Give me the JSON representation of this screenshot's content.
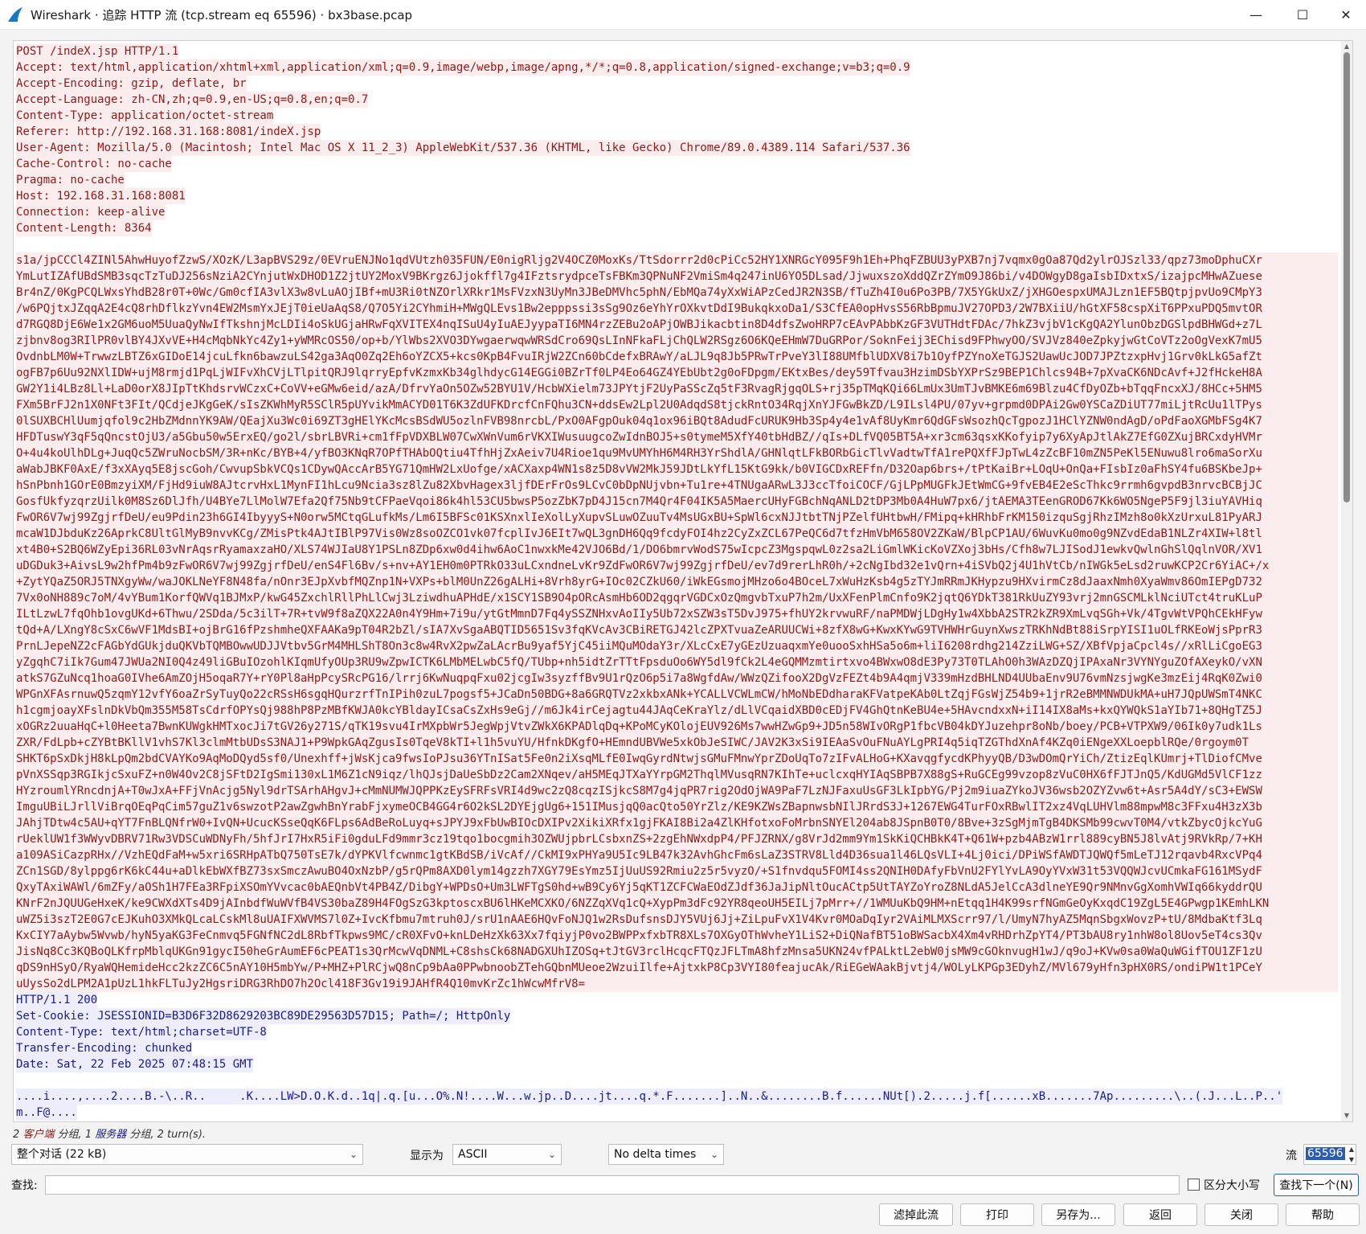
{
  "window": {
    "title": "Wireshark · 追踪 HTTP 流 (tcp.stream eq 65596) · bx3base.pcap",
    "controls": {
      "minimize": "—",
      "maximize": "☐",
      "close": "✕"
    }
  },
  "request_headers": [
    "POST /indeX.jsp HTTP/1.1",
    "Accept: text/html,application/xhtml+xml,application/xml;q=0.9,image/webp,image/apng,*/*;q=0.8,application/signed-exchange;v=b3;q=0.9",
    "Accept-Encoding: gzip, deflate, br",
    "Accept-Language: zh-CN,zh;q=0.9,en-US;q=0.8,en;q=0.7",
    "Content-Type: application/octet-stream",
    "Referer: http://192.168.31.168:8081/indeX.jsp",
    "User-Agent: Mozilla/5.0 (Macintosh; Intel Mac OS X 11_2_3) AppleWebKit/537.36 (KHTML, like Gecko) Chrome/89.0.4389.114 Safari/537.36",
    "Cache-Control: no-cache",
    "Pragma: no-cache",
    "Host: 192.168.31.168:8081",
    "Connection: keep-alive",
    "Content-Length: 8364"
  ],
  "request_body": [
    "s1a/jpCCCl4ZINl5AhwHuyofZzwS/XOzK/L3apBVS29z/0EVruENJNo1qdVUtzh035FUN/E0nigRljg2V4OCZ0MoxKs/TtSdorrr2d0cPiCc52HY1XNRGcY095F9h1Eh+PhqFZBUU3yPXB7nj7vqmx0gOa87Qd2ylrOJSzl33/qpz73moDphuCXr",
    "YmLutIZAfUBdSMB3sqcTzTuDJ256sNziA2CYnjutWxDHOD1Z2jtUY2MoxV9BKrgz6Jjokffl7g4IFztsrydpceTsFBKm3QPNuNF2VmiSm4q247inU6YO5DLsad/JjwuxszoXddQZrZYmO9J86bi/v4DOWgyD8gaIsbIDxtxS/izajpcMHwAZuese",
    "Br4nZ/0KgPCQLWxsYhdB28r0T+0Wc/Gm0cfIA3vlX3w8vLuAOjIBf+mU3Ri0tNZOrlXRkr1MsFVzxN3UyMn3JBeDMVhc5phN/EbMQa74yXxWiAPzCedJR2N3SB/fTuZh4I0u6Po3PB/7X5YGkUxZ/jXHGOespxUMAJLzn1EF5BQtpjpvUo9CMpY3",
    "/w6PQjtxJZqqA2E4cQ8rhDflkzYvn4EW2MsmYxJEjT0ieUaAqS8/Q7O5Yi2CYhmiH+MWgQLEvs1Bw2epppssi3sSg9Oz6eYhYrOXkvtDdI9BukqkxoDa1/S3CfEA0opHvsS56RbBpmuJV27OPD3/2W7BXiiU/hGtXF58cspXiT6PPxuPDQ5mvtOR",
    "d7RGQ8DjE6We1x2GM6uoM5UuaQyNwIfTkshnjMcLDIi4oSkUGjaHRwFqXVITEX4nqISuU4yIuAEJyypaTI6MN4rzZEBu2oAPjOWBJikacbtin8D4dfsZwoHRP7cEAvPAbbKzGF3VUTHdtFDAc/7hkZ3vjbV1cKgQA2YlunObzDGSlpdBHWGd+z7L",
    "zjbnv8og3RIlPR0vlBY4JXvVE+H4cMqbNkYc4Zy1+yWMRcOS50/op+b/YlWbs2XVO3DYwgaerwqwWRSdCro69QsLInNFkaFLjChQLW2RSgz6O6KQeEHmW7DuGRPor/SoknFeij3EChisd9FPhwyOO/SVJVz840eZpkyjwGtCoVTz2oOgVexK7mU5",
    "OvdnbLM0W+TrwwzLBTZ6xGIDoE14jcuLfkn6bawzuLS42ga3AqO0Zq2Eh6oYZCX5+kcs0KpB4FvuIRjW2ZCn60bCdefxBRAwY/aLJL9q8Jb5PRwTrPveY3lI88UMfblUDXV8i7b1OyfPZYnoXeTGJS2UawUcJOD7JPZtzxpHvj1Grv0kLkG5afZt",
    "ogFB7p6Uu92NXlIDW+ujM8rmjd1PqLjWIFvXhCVjLTlpitQRJ9lqrryEpfvKzmxKb34glhdycG14EGGi0BZrTf0LP4Eo64GZ4YEbUbt2g0oFDpgm/EKtxBes/dey59Tfvau3HzimDSbYXPrSz9BEP1Chlcs94B+7pXvaCK6NDcAvf+J2fHckeH8A",
    "GW2Y1i4LBz8Ll+LaD0orX8JIpTtKhdsrvWCzxC+CoVV+eGMw6eid/azA/DfrvYaOn5OZw52BYU1V/HcbWXielm73JPYtjF2UyPaSScZq5tF3RvagRjgqOLS+rj35pTMqKQi66LmUx3UmTJvBMKE6m69Blzu4CfDyOZb+bTqqFncxXJ/8HCc+5HM5",
    "FXm5BrFJ2n1X0NFt3FIt/QCdjeJKgGeK/sIsZKWhMyR5SClR5pUYvikMmACYD01T6K3ZdUFKDrcfCnFQhu3CN+ddsEw2Lpl2U0AdqdS8tjckRntO34RqjXnYJFGwBkZD/L9ILsl4PU/07yv+grpmd0DPAi2Gw0YSCaZDiUT77miLjtRcUu1lTPys",
    "0lSUXBCHlUumjqfol9c2HbZMdnnYK9AW/QEajXu3Wc0i69ZT3gHElYKcMcsBSdWU5ozlnFVB98nrcbL/PxO0AFgpOuk04q1ox96iBQt8AdudFcURUK9Hb3Sp4y4e1vAf8UyKmr6QdGFsWsozhQcTgpozJ1HClYZNW0ndAgD/oPdFaoXGMbFSg4K7",
    "HFDTuswY3qF5qQncstOjU3/a5Gbu50w5ErxEQ/go2l/sbrLBVRi+cm1fFpVDXBLW07CwXWnVum6rVKXIWusuugcoZwIdnBOJ5+s0tymeM5XfY40tbHdBZ//qIs+DLfVQ05BT5A+xr3cm63qsxKKofyip7y6XyApJtlAkZ7EfG0ZXujBRCxdyHVMr",
    "O+4u4koUlhDLg+JuqQc5ZWruNocbSM/3R+nKc/BYB+4/yfBO3KNqR7OPfTHAbOQtiu4TfhHjZxAeiv7U4Rioe1qu9MvUMYhH6M4RH3YrShdlA/GHNlqtLFkBORbGicTlvVadtwTfA1rePQXfFJpTwL4zZcBF10mZN5PeKl5ENuwu8lro6maSorXu",
    "aWabJBKF0AxE/f3xXAyq5E8jscGoh/CwvupSbkVCQs1CDywQAccArB5YG71QmHW2LxUofge/xACXaxp4WN1s8z5D8vVW2MkJ59JDtLkYfL15KtG9kk/b0VIGCDxREFfn/D32Oap6brs+/tPtKaiBr+LOqU+OnQa+FIsbIz0aFhSY4fu6BSKbeJp+",
    "hSnPbnh1GOrE0BmzyiXM/FjHd9iuW8AJtcrvHxL1MynFI1hLcu9Ncia3sz8lZu82XbvHagex3ljfDErFrOs9LCvC0bDpNUjvbn+Tu1re+4TNUgaARwL3J3ccTfoiCOCF/GjLPpMUGFkJEtWmCG+9fvEB4E2eScThkc9rrmh6gvpdB3nrvcBCBjJC",
    "GosfUkfyzqrzUilk0M8Sz6DlJfh/U4BYe7LlMolW7Efa2Qf75Nb9tCFPaeVqoi86k4hl53CU5bwsP5ozZbK7pD4J15cn7M4Qr4F04IK5A5MaercUHyFGBchNqANLD2tDP3Mb0A4HuW7px6/jtAEMA3TEenGROD67Kk6WO5NgeP5F9jl3iuYAVHiq",
    "FwOR6V7wj99ZgjrfDeU/eu9Pdin23h6GI4IbyyyS+N0orw5MCtqGLufkMs/Lm6I5BFSc01KSXnxlIeXolLyXupvSLuwOZuuTv4MsUGxBU+SpWl6cxNJJtbtTNjPZelfUHtbwH/FMipq+kHRhbFrKM150izquSgjRhzIMzh8o0kXzUrxuL81PyARJ",
    "mcaW1DJbduKz26AprkC8UltGlMyB9nvvKCg/ZMisPtk4AJtIBlP97Vis0Wz8soOZCO1vk07fcplIvJ6EIt7wQL3gnDH6Qq9fcdyFOI4hz2CyZxZCL67PeQC6d7tfzHmVbM658OV2ZKaW/BlpCP1AU/6WuvKu0mo0g9NZvdEdaB1NLZr4XIW+l8tl",
    "xt4B0+S2BQ6WZyEpi36RL03vNrAqsrRyamaxzaHO/XLS74WJIaU8Y1PSLn8ZDp6xw0d4ihw6AoC1nwxkMe42VJO6Bd/1/DO6bmrvWodS75wIcpcZ3MgspqwL0z2sa2LiGmlWKicKoVZXoj3bHs/Cfh8w7LJISodJ1ewkvQwlnGhSlQqlnVOR/XV1",
    "uDGDuk3+AivsL9w2hfPm4b9zFwOR6V7wj99ZgjrfDeU/enS4Fl6Bv/s+nv+AY1EH0m0PTRkO33uLCxndneLvKr9ZdFwOR6V7wj99ZgjrfDeU/ev7d9rerLhR0h/+2cNgIbd32e1vQrn+4iSVbQ2j4U1hVtCb/nIWGk5eLsd2ruwKCP2Cr6YiAC+/x",
    "+ZytYQaZ5ORJ5TNXgyWw/waJOKLNeYF8N48fa/nOnr3EJpXvbfMQZnp1N+VXPs+blM0UnZ26gALHi+8Vrh8yrG+IOc02CZkU60/iWkEGsmojMHzo6o4BOceL7xWuHzKsb4g5zTYJmRRmJKHypzu9HXvirmCz8dJaaxNmh0XyaWmv86OmIEPgD732",
    "7Vx0oNH889c7oM/4vYBum1KorfQWVq1BJMxP/kwG45ZxchlRllPhLlCwj3LziwdhuAPHdE/x1SCY1SB9O4pORcAsmHb6OD2qgqrVGDCxOzQmgvbTxuP7h2m/UxXFenPlmCnfo9K2jqtQ6YDkT381RkUuZY93vrj2mnGSCMLklNciUTct4truKLuP",
    "ILtLzwL7fqOhb1ovgUKd+6Thwu/2SDda/5c3ilT+7R+tvW9f8aZQX22A0n4Y9Hm+7i9u/ytGtMmnD7Fq4ySSZNHxvAoIIy5Ub72xSZW3sT5DvJ975+fhUY2krvwuRF/naPMDWjLDgHy1w4XbbA2STR2kZR9XmLvqSGh+Vk/4TgvWtVPQhCEkHFyw",
    "tQd+A/LXngY8cSxC6wVF1MdsBI+ojBrG16fPzshmheQXFAAKa9pT04R2bZl/sIA7XvSgaABQTID5651Sv3fqKVcAv3CBiRETGJ42lcZPXTvuaZeARUUCWi+8zfX8wG+KwxKYwG9TVHWHrGuynXwszTRKhNdBt88iSrpYISI1uOLfRKEoWjsPprR3",
    "PrnLJepeNZ2cFAGbYdGUkjduQKVbTQMBOwwUDJJVtbv5GrM4MHLShT8On3c8w4RvX2pwZaLAcrBu9yaf5YjC45iiMQuMOdaY3r/XLcCxE7yGEzUzuaqxmYe0uooSxhHSa5o6m+liI6208rdhg214ZziLWG+SZ/XBfVpjaCpcl4s//xRlLiCgoEG3",
    "yZgqhC7iIk7Gum47JWUa2NI0Q4z49liGBuIOzohlKIqmUfyOUp3RU9wZpwICTK6LMbMELwbC5fQ/TUbp+nh5idtZrTTtFpsduOo6WY5dl9fCk2L4eGQMMzmtirtxvo4BWxwO8dE3Py73T0TLAhO0h3WAzDZQjIPAxaNr3VYNYguZOfAXeykO/vXN",
    "atkS7GZuNcq1hoaG0IVhe6AmZOjH5oqaR7Y+rY0Pl8aHpPcySRcPG16/lrrj6KwNuqpqFxu02jcgIw3syzffBv9U1rQzO6p5i7a8WgfdAw/WWzQZifooX2DgVzFEZt4b9A4qmjV339mHzdBHLND4UUbaEnv9U76vmNzsjwgKe3mzEij4RqK0Zwi0",
    "WPGnXFAsrnuwQ5zqmY12vfY6oaZrSyTuyQo22cRSsH6sgqHQurzrfTnIPih0zuL7pogsf5+JCaDn50BDG+8a6GRQTVz2xkbxANk+YCALLVCWLmCW/hMoNbEDdharaKFVatpeKAb0LtZqjFGsWjZ54b9+1jrR2eBMMNWDUkMA+uH7JQpUWSmT4NKC",
    "h1cgmjoayXFslnDkVbQm355M58TsCdrfOPYsQj988hP8PzMBfKWJA0kcYBldayICsaCsZxHs9eGj//m6Jk4irCejagtu44JAqCeKraYlz/dLlVCqaidXBD0cEDjFV4GhQtnKeBU4e+5HAvcndxxN+iI14IX8aMs+kxQYWQkS1aYIb71+8QHgTZ5J",
    "xOGRz2uuaHqC+l0Heeta7BwnKUWgkHMTxocJi7tGV26y271S/qTK19svu4IrMXpbWr5JegWpjVtvZWkX6KPADlqDq+KPoMCyKOlojEUV926Ms7wwHZwGp9+JD5n58WIvORgP1fbcVB04kDYJuzehpr8oNb/boey/PCB+VTPXW9/06Ik0y7udk1Ls",
    "ZXR/FdLpb+cZYBtBKllV1vhS7Kl3clmMtbUDsS3NAJ1+P9WpkGAqZgusIs0TqeV8kTI+l1h5vuYU/HfnkDKgfO+HEmndUBVWe5xkObJeSIWC/JAV2K3xSi9IEAaSvOuFNuAYLgPRI4q5iqTZGThdXnAf4KZq0iENgeXXLoepblRQe/0rgoym0T",
    "SHKT6pSxDkjH8kLpQm2bdCVAYKo9AqMoDQyd5sf0/Unexhff+jWsKjca9fwsIoPJsu36YTnISat5Fe0n2iXsqMLfE0IwqGyrdNtwjsGMuFMnwYprZDoUqTo7zIFvALHoG+KXavqgfycdKPhyyQB/D3wDOmQrYiCh/ZtizEqlKUmrj+TlDiofCMve",
    "pVnXSSqp3RGIkjcSxuFZ+n0W4Ov2C8jSFtD2IgSmi130xL1M6Z1cN9iqz/lhQJsjDaUeSbDz2Cam2XNqev/aH5MEqJTXaYYrpGM2ThqlMVusqRN7KIhTe+uclcxqHYIAqSBPB7X88gS+RuGCEg99vzop8zVuC0HX6fFJTJnQ5/KdUGMd5VlCF1zz",
    "HYzroumlYRncdnjA+T0wJxA+FFjVnAcjg5Nyl9drTSArhAHgvJ+cMmNUMWJQPPKzEySFRFsVRI4d9wc2zQ8cqzISjkcS8M7g4jqPR7rig2OdOjWA9PaF7LzNJFaxuUsGF3LkIpbYG/Pj2m9iuaZYkoJV36wsb2OZYZvw6t+Asr5A4dY/sC3+EWSW",
    "ImguUBiLJrllViBrqOEqPqCim57guZ1v6swzotP2awZgwhBnYrabFjxymeOCB4GG4r6O2kSL2DYEjgUg6+151IMusjqQ0acQto50YrZlz/KE9KZWsZBapnwsbNIlJRrdS3J+1267EWG4TurFOxRBwlIT2xz4VqLUHVlm88mpwM8c3FFxu4H3zX3b",
    "JAhjTDtw4c5AU+qYT7FnBLQNfrW0+IvQN+UcucKSseQqK6FLps6AdBeRoLuyq+sJPYJ9xFbUwBIOcDXIPv2XikiXRfx1gjFKAI8Bi2a4ZlKHfotxoFoMrbnSNYEl204ab8JSpnB0T0/8Bve+3zSgMjmTgB4DKSMb99cwvT0M4/vtkZbycOjkcYuG",
    "rUeklUW1f3WWyvDBRV71Rw3VDSCuWDNyFh/5hfJrI7HxR5iFi0gduLFd9mmr3cz19tqo1bocgmih3OZWUjpbrLCsbxnZS+2zgEhNWxdpP4/PFJZRNX/g8VrJd2mm9Ym1SkKiQCHBkK4T+Q61W+pzb4ABzW1rrl889cyBN5J8lvAtj9RVkRp/7+KH",
    "a109ASiCazpRHx//VzhEQdFaM+w5xri6SRHpATbQ750TsE7k/dYPKVlfcwnmc1gtKBdSB/iVcAf//CkMI9xPHYa9U5Ic9LB47k32AvhGhcFm6sLaZ3STRV8Lld4D36sua1l46LQsVLI+4Lj0ici/DPiWSfAWDTJQWQf5mLeTJ12rqavb4RxcVPq4",
    "ZCn1SGD/8ylppg6rK6kC44u+aDlkEbWXfBZ73sxSmczAwuBO4OxNzbP/g5rQPm8AXD0lym14gzzh7XGY79EsYmz5IjUuUS92Rmiu2z5r5vyzO/+S1fnvdqu5FOMI4ss2QNIH0DAfyFbVnU2FYlYvLA9OyYVxW31t53VQQWJcvUCmkaFG161MSydF",
    "QxyTAxiWAWl/6mZFy/aOSh1H7FEa3RFpiXSOmYVvcac0bAEQnbVt4PB4Z/DibgY+WPDsO+Um3LWFTgS0hd+wB9Cy6Yj5qKT1ZCFCWaEOdZJdf36JaJipNltOucACtp5UtTAYZoYroZ8NLdA5JelCcA3dlneYE9Qr9NMnvGgXomhVWIq66kyddrQU",
    "KNrF2nJQUUGeHxeK/ke9CWXdXTs4D9jAInbdfWuWVfB4VS30baZ89H4FOgSzG3kptoscxBU6lHKeMCXKO/6NZZqXVq1cQ+XypPm3dFc92YR8qeoUH5EILj7pMrr+//1WMUuKbQ9HM+nEtqq1H4K99srfNGmGeOyKxqdC19ZgL5E4GPwgp1KEmhLKN",
    "uWZ5i3szT2E0G7cEJKuhO3XMkQLcaLCskMl8uUAIFXWVMS7l0Z+IvcKfbmu7mtruh0J/srU1nAAE6HQvFoNJQ1w2RsDufsnsDJY5VUj6Jj+ZiLpuFvX1V4Kvr0MOaDqIyr2VAiMLMXScrr97/l/UmyN7hyAZ5MqnSbgxWovzP+tU/8MdbaKtf3Lq",
    "KxCIY7aAybw5Wvwb/hyN5yaKG3FeCnmvq5FGNfNC2dL8RbfTkpws9MC/cR0XFvO+knLDeHzXk63Xx7fqiyjP0vo2BWPPxfxbTR8XLs7OXGyOThWvheY1LiS2+DiQNafBT51oBWSacbX4Xm4vRHDrhZpYT4/PT3bAU8ry1nhW8ol8Uov5eT4cs3Qv",
    "JisNq8Cc3KQBoQLKfrpMblqUKGn91gycI50heGrAumEF6cPEAT1s3QrMcwVqDNML+C8shsCk68NADGXUhIZOSq+tJtGV3rclHcqcFTQzJFLTmA8hfzMnsa5UKN24vfPALktL2ebW0jsMW9cGOknvugH1wJ/q9oJ+KVw0sa0WaQuWGifTOU1ZF1zU",
    "qDS9nHSyO/RyaWQHemideHcc2kzZC6C5nAY10H5mbYw/P+MHZ+PlRCjwQ8nCp9bAa0PPwbnoobZTehGQbnMUeoe2WzuiIlfe+AjtxkP8Cp3VYI80feajucAk/RiEGeWAakBjvtj4/WOLyLKPGp3EDyhZ/MVl679yHfn3pHX0RS/ondiPW1t1PCeY",
    "uUysSo2dLPM2A1pUzL1hkFLTuJy2HgsriDRG3RhDO7h2Ocl418F3Gv19i9JAHfR4Q10mvKrZc1hWcwMfrV8="
  ],
  "response_headers": [
    "HTTP/1.1 200",
    "Set-Cookie: JSESSIONID=B3D6F32D8629203BC89DE29563D57D15; Path=/; HttpOnly",
    "Content-Type: text/html;charset=UTF-8",
    "Transfer-Encoding: chunked",
    "Date: Sat, 22 Feb 2025 07:48:15 GMT"
  ],
  "response_body": [
    "....i....,....2....B.-\\..R..     .K....LW>D.O.K.d..1q|.q.[u...O%.N!....W...w.jp..D....jt....q.*.F.......]..N..&........B.f......NUt[).2.....j.f[......xB.......7Ap.........\\..(.J...L..P..'",
    "m..F@...."
  ],
  "stats": {
    "prefix": "2 ",
    "client_label": "客户端",
    "mid1": " 分组, 1 ",
    "server_label": "服务器",
    "suffix": " 分组, 2 turn(s)."
  },
  "controls": {
    "conversation_select": "整个对话 (22 kB)",
    "show_as_label": "显示为",
    "show_as_select": "ASCII",
    "delta_select": "No delta times",
    "stream_label": "流",
    "stream_value": "65596",
    "find_label": "查找:",
    "find_value": "",
    "case_checkbox_label": "区分大小写",
    "find_next_button": "查找下一个(N)"
  },
  "buttons": {
    "filter_out": "滤掉此流",
    "print": "打印",
    "save_as": "另存为...",
    "back": "返回",
    "close": "关闭",
    "help": "帮助"
  },
  "colors": {
    "client_text": "#8b1a1a",
    "client_bg": "#fbeded",
    "server_text": "#1a1a8b",
    "server_bg": "#ededfb",
    "accent": "#2a5db0"
  }
}
